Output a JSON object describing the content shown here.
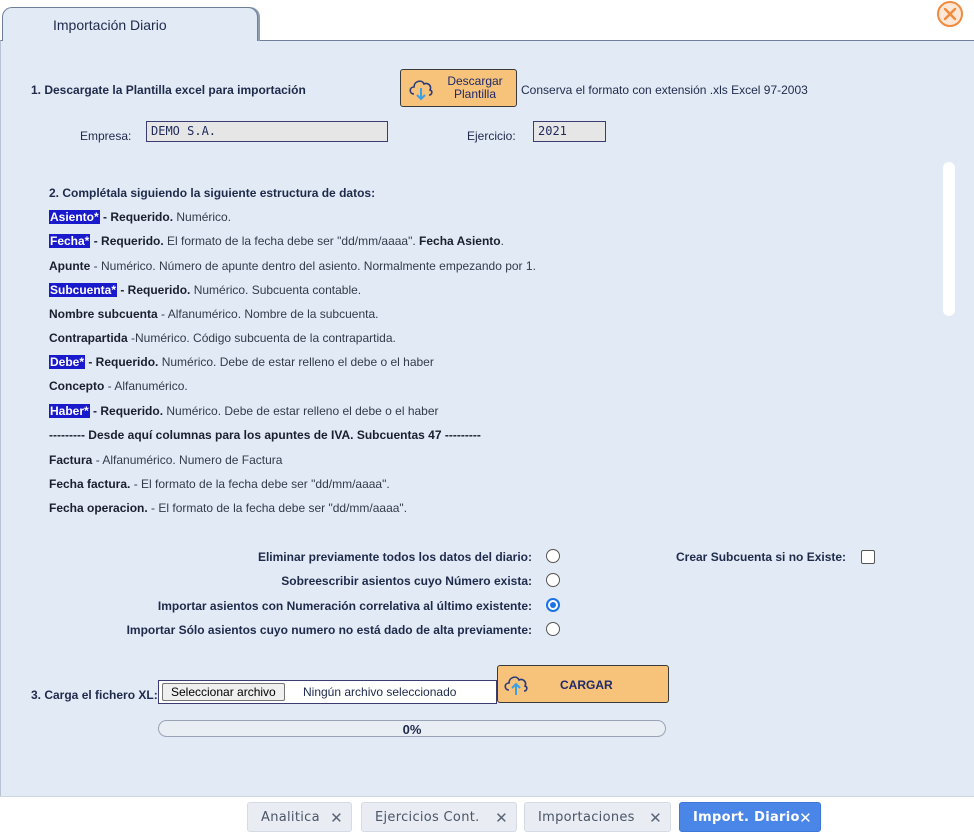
{
  "window": {
    "tab_title": "Importación Diario"
  },
  "step1": {
    "label": "1. Descargate la Plantilla excel para importación",
    "download_button": "Descargar Plantilla",
    "format_note": "Conserva el formato con extensión .xls Excel 97-2003",
    "empresa_label": "Empresa:",
    "empresa_value": "DEMO S.A.",
    "ejercicio_label": "Ejercicio:",
    "ejercicio_value": "2021"
  },
  "step2": {
    "title": "2. Complétala siguiendo la siguiente estructura de datos:",
    "fields": [
      {
        "name": "Asiento*",
        "highlight": true,
        "req": " - Requerido.",
        "desc": " Numérico.",
        "extra": ""
      },
      {
        "name": "Fecha*",
        "highlight": true,
        "req": " - Requerido.",
        "desc": " El formato de la fecha debe ser \"dd/mm/aaaa\". ",
        "extra": "Fecha Asiento"
      },
      {
        "name": "Apunte",
        "highlight": false,
        "req": "",
        "desc": " - Numérico. Número de apunte dentro del asiento. Normalmente empezando por 1.",
        "extra": ""
      },
      {
        "name": "Subcuenta*",
        "highlight": true,
        "req": " - Requerido.",
        "desc": " Numérico. Subcuenta contable.",
        "extra": ""
      },
      {
        "name": "Nombre subcuenta",
        "highlight": false,
        "req": "",
        "desc": " - Alfanumérico. Nombre de la subcuenta.",
        "extra": ""
      },
      {
        "name": "Contrapartida",
        "highlight": false,
        "req": "",
        "desc": "  -Numérico. Código subcuenta de la contrapartida.",
        "extra": ""
      },
      {
        "name": "Debe*",
        "highlight": true,
        "req": " - Requerido.",
        "desc": " Numérico. Debe de estar relleno el debe o el haber",
        "extra": ""
      },
      {
        "name": "Concepto",
        "highlight": false,
        "req": "",
        "desc": " - Alfanumérico.",
        "extra": ""
      },
      {
        "name": "Haber*",
        "highlight": true,
        "req": " - Requerido.",
        "desc": " Numérico. Debe de estar relleno el debe o el haber",
        "extra": ""
      },
      {
        "name": "--------- Desde aquí columnas para los apuntes de IVA. Subcuentas 47 ---------",
        "highlight": false,
        "req": "",
        "desc": "",
        "extra": ""
      },
      {
        "name": "Factura",
        "highlight": false,
        "req": "",
        "desc": " - Alfanumérico. Numero de Factura",
        "extra": ""
      },
      {
        "name": "Fecha factura.",
        "highlight": false,
        "req": "",
        "desc": " - El formato de la fecha debe ser \"dd/mm/aaaa\".",
        "extra": ""
      },
      {
        "name": "Fecha operacion.",
        "highlight": false,
        "req": "",
        "desc": " - El formato de la fecha debe ser \"dd/mm/aaaa\".",
        "extra": ""
      }
    ]
  },
  "options": {
    "items": [
      {
        "label": "Eliminar previamente todos los datos del diario:",
        "selected": false
      },
      {
        "label": "Sobreescribir asientos cuyo Número exista:",
        "selected": false
      },
      {
        "label": "Importar asientos con Numeración correlativa al último existente:",
        "selected": true
      },
      {
        "label": "Importar Sólo asientos cuyo numero no está dado de alta previamente:",
        "selected": false
      }
    ],
    "crear_subcuenta_label": "Crear Subcuenta si no Existe:"
  },
  "step3": {
    "label": "3. Carga el fichero XL:",
    "file_button": "Seleccionar archivo",
    "file_status": "Ningún archivo seleccionado",
    "load_button": "CARGAR",
    "progress_percent": 0,
    "progress_text": "0%"
  },
  "bottom_tabs": [
    {
      "label": "Analitica",
      "active": false
    },
    {
      "label": "Ejercicios Cont.",
      "active": false
    },
    {
      "label": "Importaciones",
      "active": false
    },
    {
      "label": "Import. Diario",
      "active": true
    }
  ],
  "colors": {
    "accent": "#4a86e8",
    "button_orange": "#f7c27a",
    "highlight_blue": "#1a1acd",
    "panel_bg": "#e2eaf5"
  }
}
